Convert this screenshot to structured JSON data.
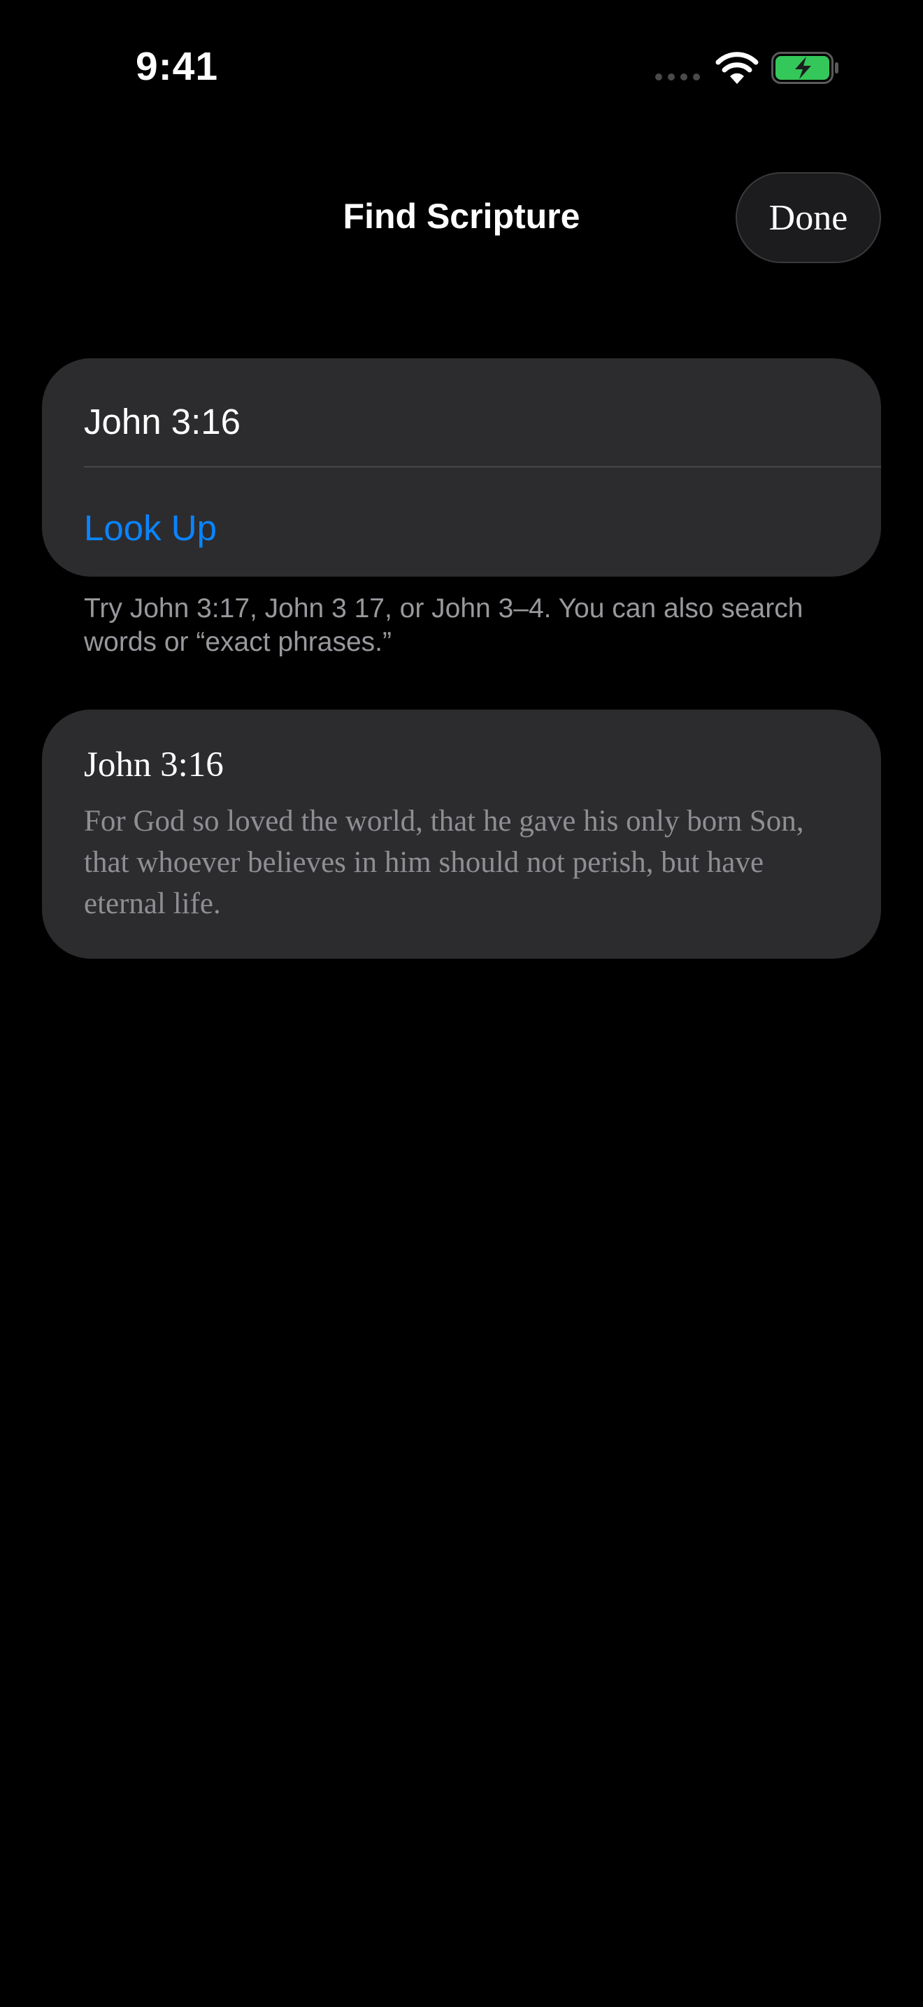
{
  "status_bar": {
    "time": "9:41",
    "battery_color": "#34c759"
  },
  "header": {
    "title": "Find Scripture",
    "done_label": "Done"
  },
  "search": {
    "value": "John 3:16",
    "lookup_label": "Look Up",
    "accent_color": "#0a84ff"
  },
  "hint": "Try John 3:17, John 3 17, or John 3–4. You can also search words or “exact phrases.”",
  "result": {
    "reference": "John 3:16",
    "text": "For God so loved the world, that he gave his only born Son, that whoever believes in him should not perish, but have eternal life."
  },
  "icons": [
    "cellular-signal-icon",
    "wifi-icon",
    "battery-charging-icon"
  ]
}
